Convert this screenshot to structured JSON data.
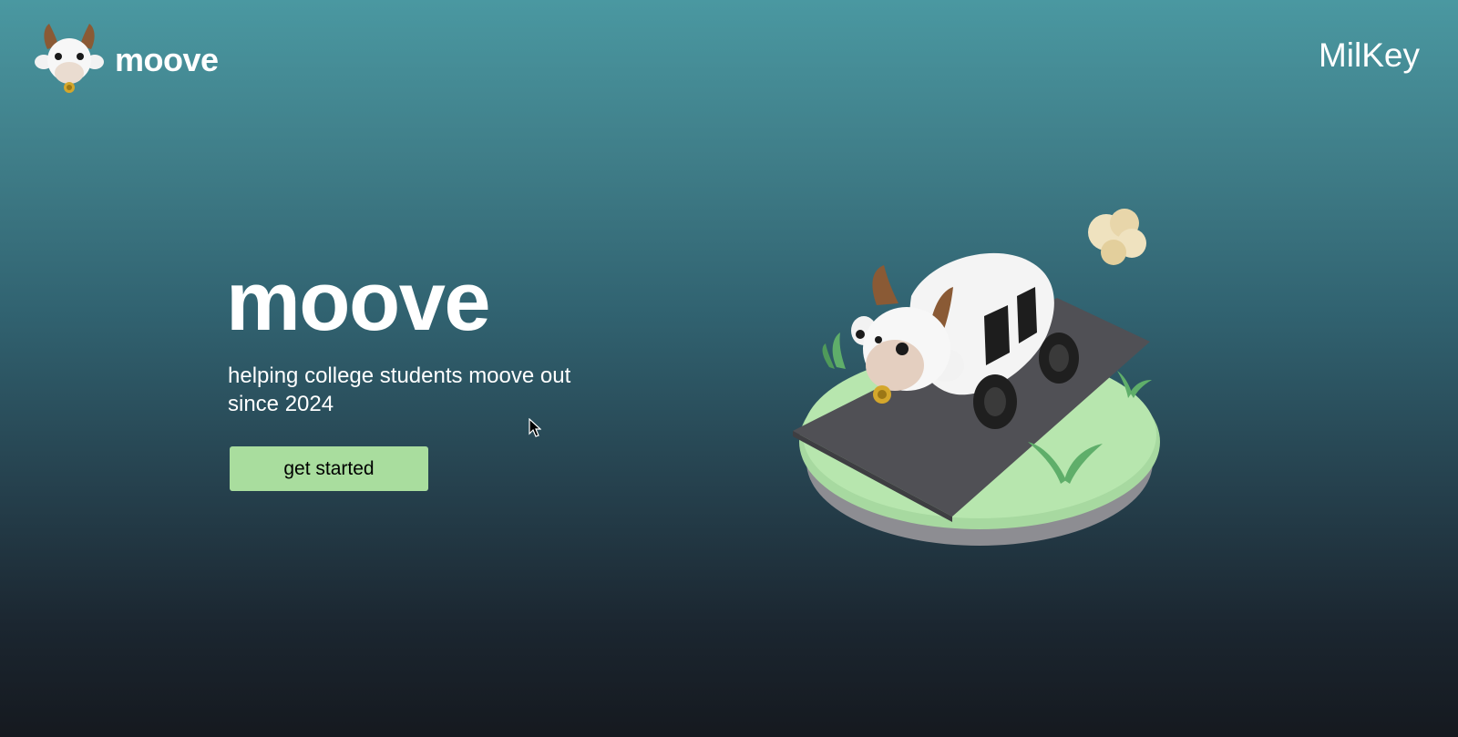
{
  "header": {
    "brand": "moove",
    "nav_link": "MilKey"
  },
  "hero": {
    "title": "moove",
    "tagline": "helping college students moove out since 2024",
    "cta_label": "get started"
  },
  "colors": {
    "accent_button": "#a9dd9e",
    "background_top": "#4a98a1",
    "background_bottom": "#15191f",
    "text": "#ffffff"
  },
  "icons": {
    "logo": "cow-head-icon",
    "cursor": "mouse-pointer-icon"
  }
}
